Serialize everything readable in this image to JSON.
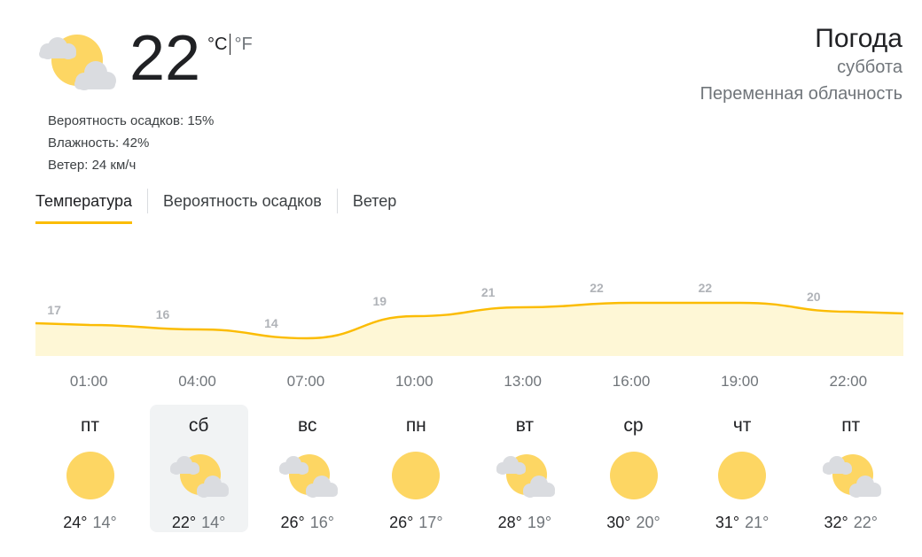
{
  "current": {
    "temperature": "22",
    "unit_c": "°C",
    "unit_f": "°F",
    "icon": "partly-cloudy-icon",
    "precipitation": "Вероятность осадков: 15%",
    "humidity": "Влажность: 42%",
    "wind": "Ветер: 24 км/ч"
  },
  "header": {
    "title": "Погода",
    "day": "суббота",
    "condition": "Переменная облачность"
  },
  "tabs": [
    {
      "label": "Температура",
      "active": true
    },
    {
      "label": "Вероятность осадков",
      "active": false
    },
    {
      "label": "Ветер",
      "active": false
    }
  ],
  "chart_data": {
    "type": "area",
    "x": [
      "01:00",
      "04:00",
      "07:00",
      "10:00",
      "13:00",
      "16:00",
      "19:00",
      "22:00"
    ],
    "values": [
      17,
      16,
      14,
      19,
      21,
      22,
      22,
      20
    ],
    "ylim": [
      10,
      24
    ],
    "line_color": "#fbbc04",
    "fill_color": "#fef7d6",
    "label_color": "#b0b3b8"
  },
  "forecast": [
    {
      "day": "пт",
      "icon": "sunny-icon",
      "high": "24°",
      "low": "14°",
      "selected": false
    },
    {
      "day": "сб",
      "icon": "partly-cloudy-icon",
      "high": "22°",
      "low": "14°",
      "selected": true
    },
    {
      "day": "вс",
      "icon": "partly-cloudy-icon",
      "high": "26°",
      "low": "16°",
      "selected": false
    },
    {
      "day": "пн",
      "icon": "sunny-icon",
      "high": "26°",
      "low": "17°",
      "selected": false
    },
    {
      "day": "вт",
      "icon": "partly-cloudy-icon",
      "high": "28°",
      "low": "19°",
      "selected": false
    },
    {
      "day": "ср",
      "icon": "sunny-icon",
      "high": "30°",
      "low": "20°",
      "selected": false
    },
    {
      "day": "чт",
      "icon": "sunny-icon",
      "high": "31°",
      "low": "21°",
      "selected": false
    },
    {
      "day": "пт",
      "icon": "partly-cloudy-icon",
      "high": "32°",
      "low": "22°",
      "selected": false
    }
  ],
  "colors": {
    "sun": "#fdd663",
    "cloud": "#dadce0",
    "accent": "#fbbc04"
  }
}
